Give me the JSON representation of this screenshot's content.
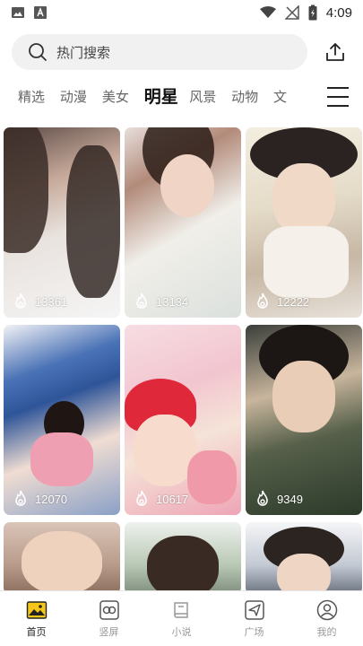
{
  "status_bar": {
    "time": "4:09",
    "icons_left": [
      "image-icon",
      "text-a-icon"
    ],
    "icons_right": [
      "wifi-icon",
      "no-signal-icon",
      "battery-charging-icon"
    ]
  },
  "search": {
    "placeholder": "热门搜索"
  },
  "tabs": [
    {
      "label": "精选",
      "active": false
    },
    {
      "label": "动漫",
      "active": false
    },
    {
      "label": "美女",
      "active": false
    },
    {
      "label": "明星",
      "active": true
    },
    {
      "label": "风景",
      "active": false
    },
    {
      "label": "动物",
      "active": false
    },
    {
      "label": "文",
      "active": false
    }
  ],
  "cards": [
    {
      "count": "13361"
    },
    {
      "count": "13134"
    },
    {
      "count": "12222"
    },
    {
      "count": "12070"
    },
    {
      "count": "10617"
    },
    {
      "count": "9349"
    },
    {
      "count": ""
    },
    {
      "count": ""
    },
    {
      "count": ""
    }
  ],
  "bottom_nav": [
    {
      "label": "首页",
      "icon": "home-image-icon",
      "active": true
    },
    {
      "label": "竖屏",
      "icon": "portrait-screen-icon",
      "active": false
    },
    {
      "label": "小说",
      "icon": "book-icon",
      "active": false
    },
    {
      "label": "广场",
      "icon": "paper-plane-icon",
      "active": false
    },
    {
      "label": "我的",
      "icon": "profile-icon",
      "active": false
    }
  ],
  "colors": {
    "active_tab": "#111111",
    "inactive_tab": "#666666",
    "nav_active_accent": "#f5c518",
    "search_bg": "#f1f1f1"
  }
}
